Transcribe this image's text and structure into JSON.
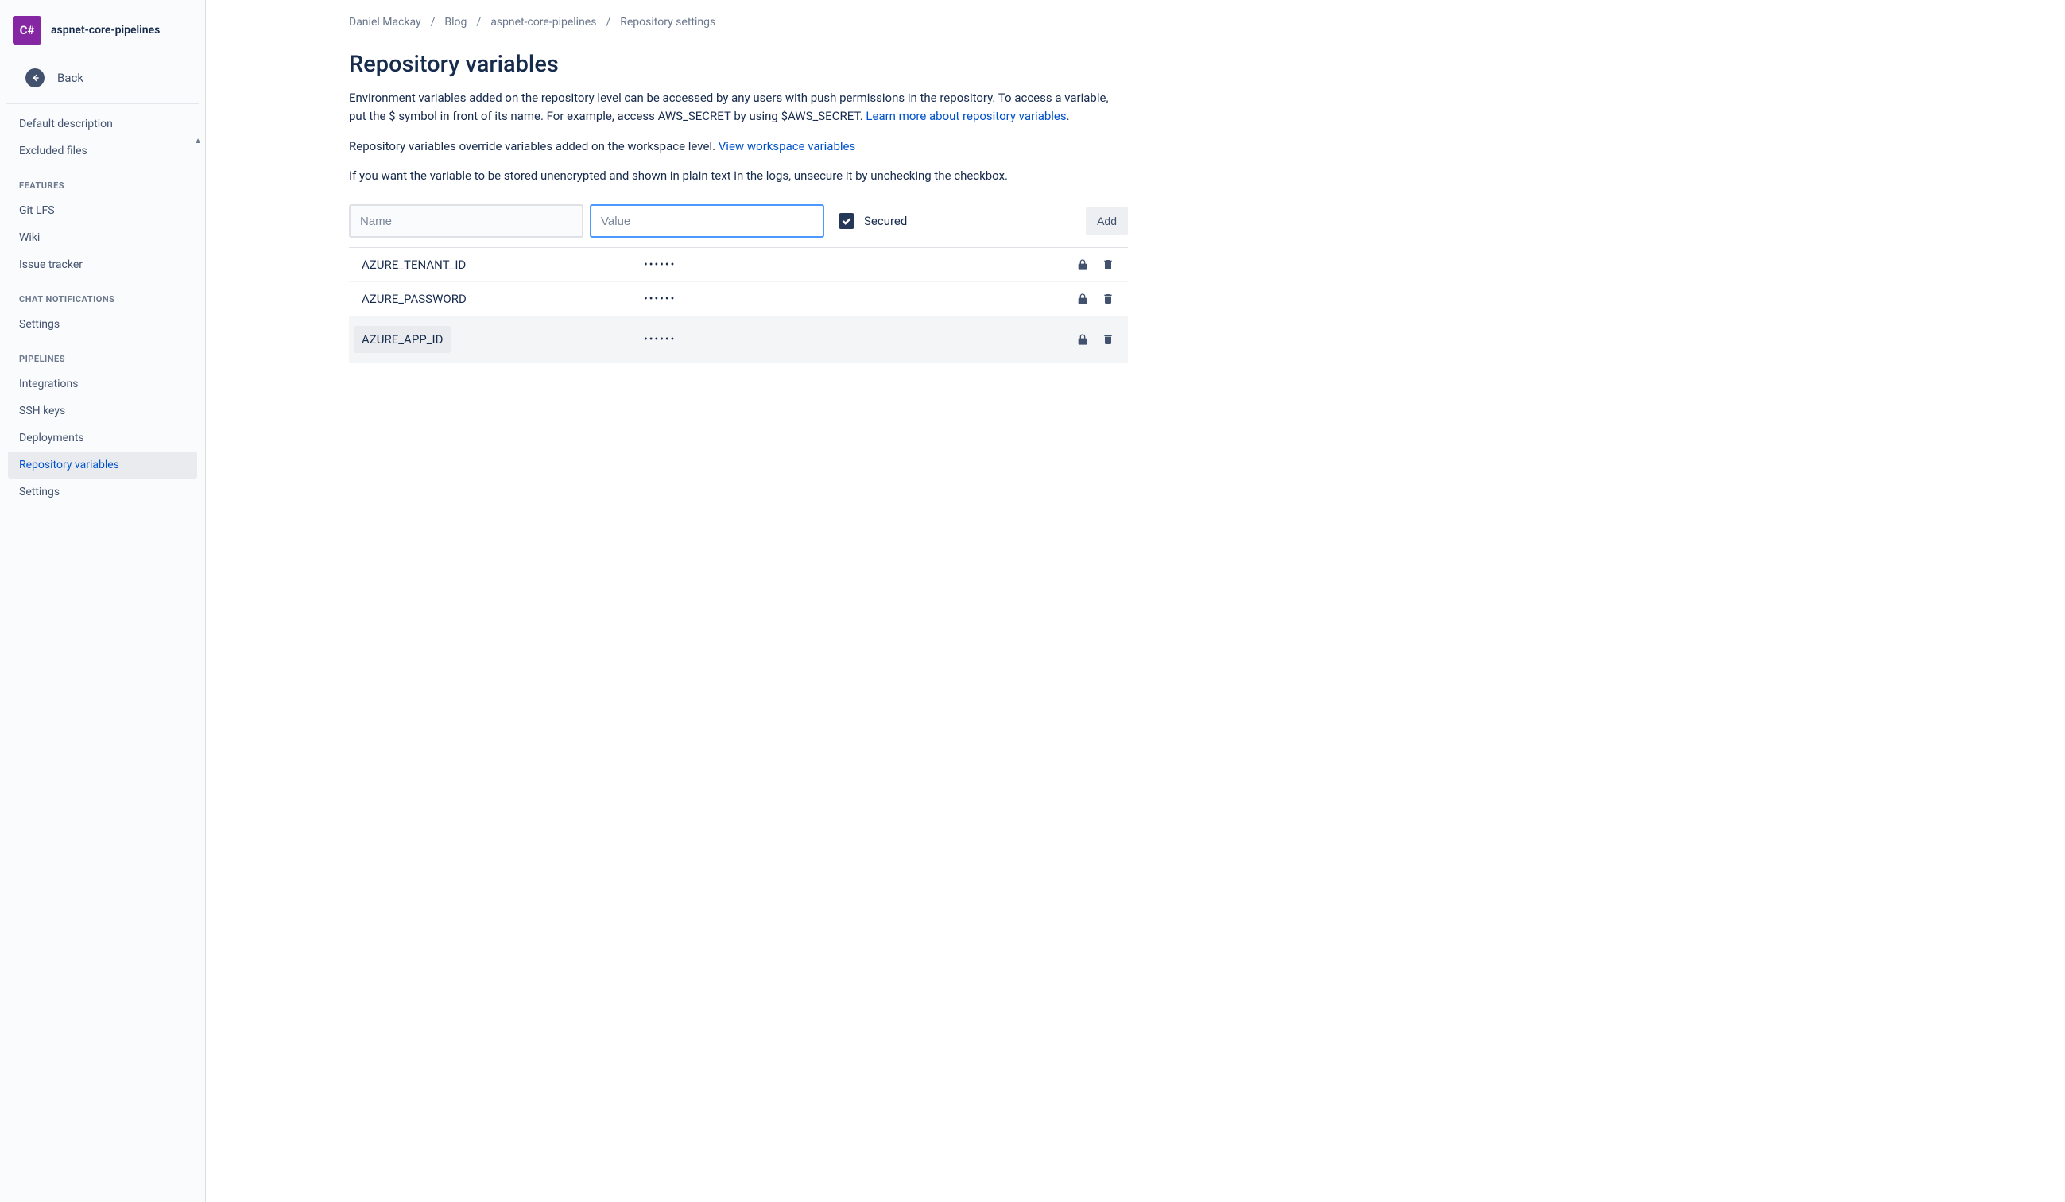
{
  "sidebar": {
    "repo_icon_text": "C#",
    "repo_name": "aspnet-core-pipelines",
    "back_label": "Back",
    "items_top": [
      {
        "label": "Default description"
      },
      {
        "label": "Excluded files"
      }
    ],
    "sections": [
      {
        "header": "FEATURES",
        "items": [
          {
            "label": "Git LFS"
          },
          {
            "label": "Wiki"
          },
          {
            "label": "Issue tracker"
          }
        ]
      },
      {
        "header": "CHAT NOTIFICATIONS",
        "items": [
          {
            "label": "Settings"
          }
        ]
      },
      {
        "header": "PIPELINES",
        "items": [
          {
            "label": "Integrations"
          },
          {
            "label": "SSH keys"
          },
          {
            "label": "Deployments"
          },
          {
            "label": "Repository variables",
            "active": true
          },
          {
            "label": "Settings"
          }
        ]
      }
    ]
  },
  "breadcrumb": {
    "items": [
      "Daniel Mackay",
      "Blog",
      "aspnet-core-pipelines",
      "Repository settings"
    ]
  },
  "page": {
    "title": "Repository variables",
    "description1_a": "Environment variables added on the repository level can be accessed by any users with push permissions in the repository. To access a variable, put the $ symbol in front of its name. For example, access AWS_SECRET by using $AWS_SECRET. ",
    "description1_link": "Learn more about repository variables",
    "description2_a": "Repository variables override variables added on the workspace level. ",
    "description2_link": "View workspace variables",
    "description3": "If you want the variable to be stored unencrypted and shown in plain text in the logs, unsecure it by unchecking the checkbox."
  },
  "form": {
    "name_placeholder": "Name",
    "value_placeholder": "Value",
    "secured_label": "Secured",
    "add_button": "Add"
  },
  "variables": [
    {
      "name": "AZURE_TENANT_ID",
      "value": "••••••",
      "highlighted": false
    },
    {
      "name": "AZURE_PASSWORD",
      "value": "••••••",
      "highlighted": false
    },
    {
      "name": "AZURE_APP_ID",
      "value": "••••••",
      "highlighted": true
    }
  ]
}
